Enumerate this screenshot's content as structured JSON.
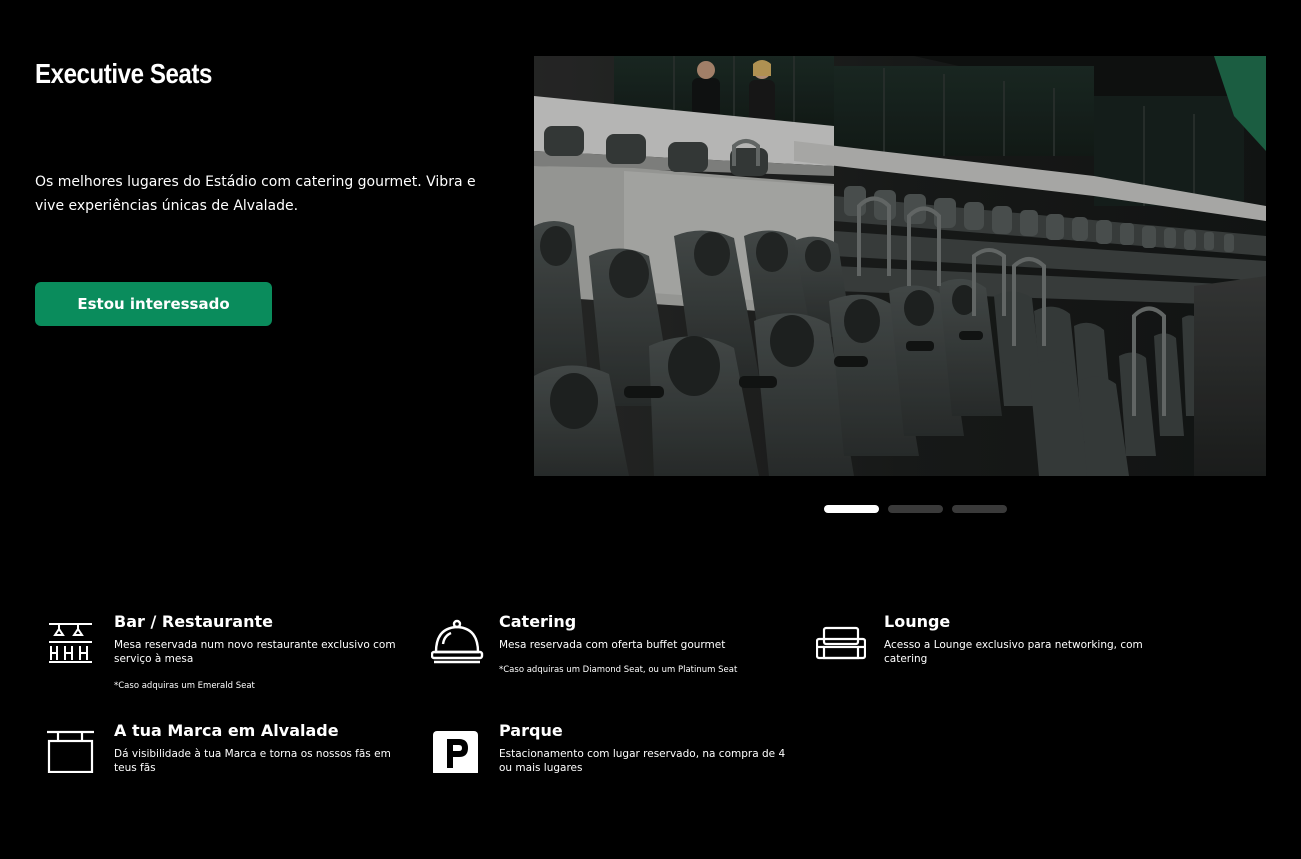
{
  "hero": {
    "title": "Executive Seats",
    "description": "Os melhores lugares do Estádio com catering gourmet. Vibra e vive experiências únicas de Alvalade.",
    "cta_label": "Estou interessado"
  },
  "carousel": {
    "slide_count": 3,
    "active_index": 0
  },
  "features": [
    {
      "icon": "bar-restaurant-icon",
      "title": "Bar / Restaurante",
      "description": "Mesa reservada num novo restaurante exclusivo com serviço à mesa",
      "note": "*Caso adquiras um Emerald Seat"
    },
    {
      "icon": "catering-bell-icon",
      "title": "Catering",
      "description": "Mesa reservada com oferta buffet gourmet",
      "note": "*Caso adquiras um Diamond Seat, ou um Platinum Seat"
    },
    {
      "icon": "lounge-sofa-icon",
      "title": "Lounge",
      "description": "Acesso a Lounge exclusivo para networking, com catering",
      "note": ""
    },
    {
      "icon": "brand-billboard-icon",
      "title": "A tua Marca em Alvalade",
      "description": "Dá visibilidade à tua Marca e torna os nossos fãs em teus fãs",
      "note": ""
    },
    {
      "icon": "parking-icon",
      "title": "Parque",
      "description": "Estacionamento com lugar reservado, na compra de 4 ou mais lugares",
      "note": ""
    }
  ],
  "colors": {
    "background": "#000000",
    "accent": "#0a8c5c",
    "dot_inactive": "#3a3a3a",
    "dot_active": "#ffffff"
  }
}
